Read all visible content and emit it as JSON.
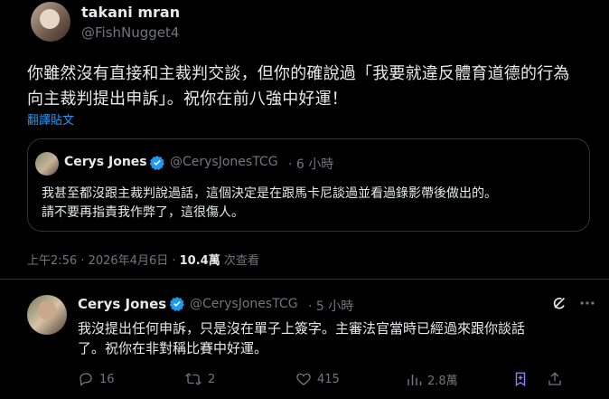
{
  "main_post": {
    "display_name": "takani mran",
    "handle": "@FishNugget4",
    "text_line1": "你雖然沒有直接和主裁判交談，但你的確說過「我要就違反體育道德的行為",
    "text_line2": "向主裁判提出申訴」。祝你在前八強中好運！",
    "translate_link": "翻譯貼文",
    "timestamp": "上午2:56 · 2026年4月6日 ·",
    "views_count": "10.4萬",
    "views_label": "次查看"
  },
  "quoted_post": {
    "display_name": "Cerys Jones",
    "handle": "@CerysJonesTCG",
    "time": "· 6 小時",
    "text_line1": "我甚至都沒跟主裁判說過話，這個決定是在跟馬卡尼談過並看過錄影帶後做出的。",
    "text_line2": "請不要再指責我作弊了，這很傷人。"
  },
  "reply": {
    "display_name": "Cerys Jones",
    "handle": "@CerysJonesTCG",
    "time": "· 5 小時",
    "text_line1": "我沒提出任何申訴，只是沒在單子上簽字。主審法官當時已經過來跟你談話",
    "text_line2": "了。祝你在非對稱比賽中好運。",
    "actions": {
      "reply_count": "16",
      "repost_count": "2",
      "like_count": "415",
      "views_count": "2.8萬"
    }
  },
  "colors": {
    "background": "#000000",
    "text": "#e7e9ea",
    "muted": "#71767b",
    "link": "#1d9bf0",
    "verified": "#1d9bf0",
    "border": "#2f3336"
  }
}
